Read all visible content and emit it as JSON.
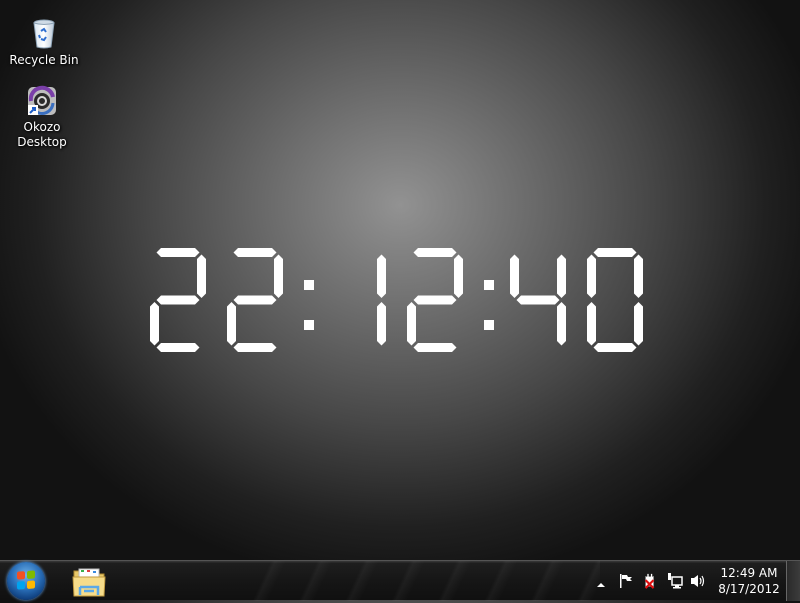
{
  "desktop": {
    "icons": [
      {
        "label": "Recycle Bin",
        "icon": "recycle-bin-icon"
      },
      {
        "label_line1": "Okozo",
        "label_line2": "Desktop",
        "icon": "okozo-desktop-icon"
      }
    ]
  },
  "clock_widget": {
    "hours": "22",
    "minutes": "12",
    "seconds": "40",
    "separator": ":",
    "digit_color": "#ffffff"
  },
  "taskbar": {
    "start_button": "windows-start-icon",
    "pinned": [
      {
        "name": "Windows Explorer",
        "icon": "folder-explorer-icon"
      }
    ],
    "tray": {
      "show_hidden_icon": "up-arrow-icon",
      "icons": [
        "action-center-flag-icon",
        "power-unplugged-icon",
        "network-icon",
        "volume-icon"
      ],
      "time": "12:49 AM",
      "date": "8/17/2012"
    }
  }
}
